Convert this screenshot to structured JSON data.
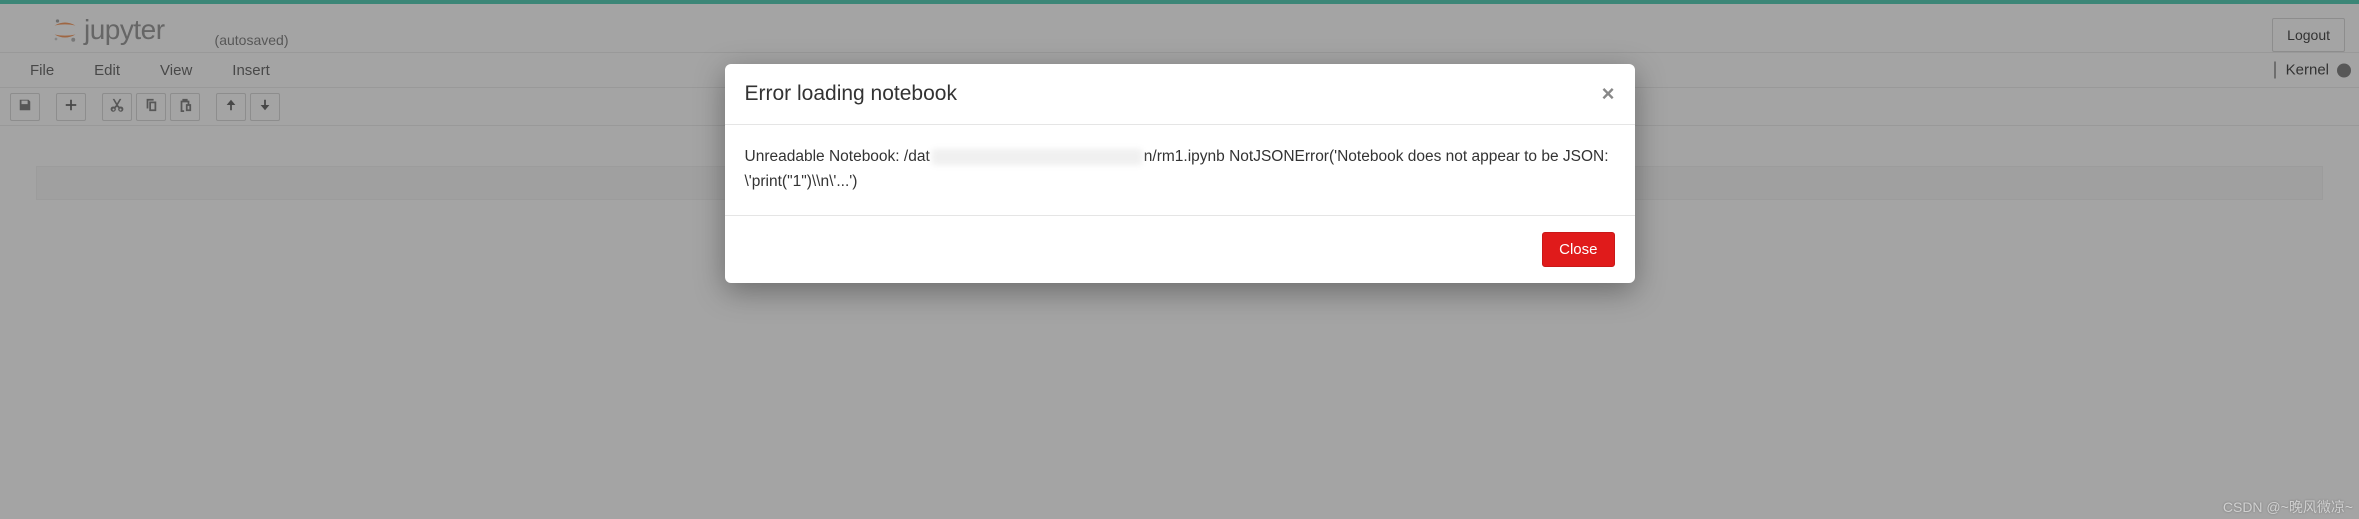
{
  "brand": {
    "name": "jupyter",
    "autosave_text": "(autosaved)"
  },
  "header": {
    "logout_label": "Logout"
  },
  "menubar": {
    "items": [
      "File",
      "Edit",
      "View",
      "Insert"
    ],
    "kernel_label": "Kernel",
    "kernel_status_icon": "circle-filled"
  },
  "toolbar": {
    "icons": [
      {
        "name": "save-icon",
        "glyph": "save"
      },
      {
        "name": "add-icon",
        "glyph": "plus"
      },
      {
        "name": "cut-icon",
        "glyph": "cut"
      },
      {
        "name": "copy-icon",
        "glyph": "copy"
      },
      {
        "name": "paste-icon",
        "glyph": "paste"
      },
      {
        "name": "move-up-icon",
        "glyph": "arrow-up"
      },
      {
        "name": "move-down-icon",
        "glyph": "arrow-down"
      }
    ]
  },
  "modal": {
    "title": "Error loading notebook",
    "body_prefix": "Unreadable Notebook: /dat",
    "body_obscured": true,
    "body_mid": "n/rm1.ipynb NotJSONError('Notebook does not appear to be JSON: \\'print(\"1\")\\\\n\\'...')",
    "close_label": "Close",
    "close_x": "×"
  },
  "watermark": "CSDN @~晚风微凉~"
}
